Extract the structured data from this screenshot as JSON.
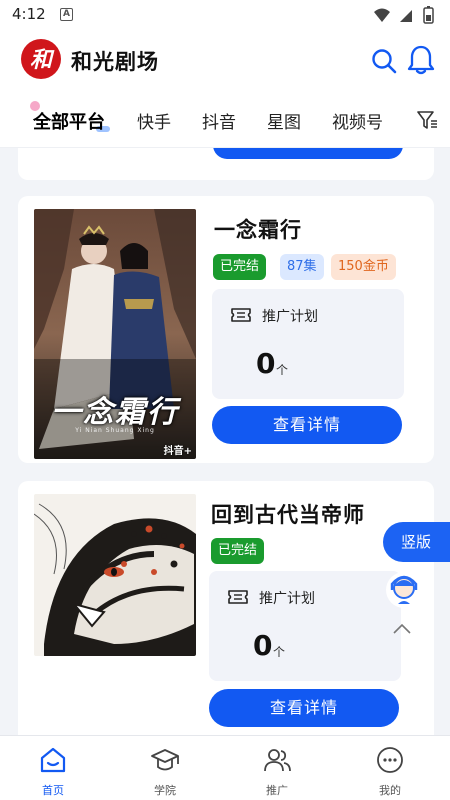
{
  "status_bar": {
    "time": "4:12",
    "notification_letter": "A"
  },
  "header": {
    "logo_char": "和",
    "title": "和光剧场",
    "icons": [
      "search-icon",
      "bell-icon"
    ]
  },
  "tabs": [
    {
      "label": "全部平台",
      "active": true
    },
    {
      "label": "快手",
      "active": false
    },
    {
      "label": "抖音",
      "active": false
    },
    {
      "label": "星图",
      "active": false
    },
    {
      "label": "视频号",
      "active": false
    }
  ],
  "dramas": [
    {
      "title": "一念霜行",
      "poster_caption": "一念霜行",
      "poster_subtitle": "Yi Nian Shuang Xing",
      "poster_watermark": "抖音+",
      "tags": [
        "已完结",
        "87集",
        "150金币"
      ],
      "plan_label": "推广计划",
      "plan_count": "0",
      "plan_unit": "个",
      "button_label": "查看详情"
    },
    {
      "title": "回到古代当帝师",
      "tags": [
        "已完结"
      ],
      "plan_label": "推广计划",
      "plan_count": "0",
      "plan_unit": "个",
      "button_label": "查看详情"
    }
  ],
  "floating": {
    "vertical_label": "竖版"
  },
  "bottom_nav": [
    {
      "label": "首页",
      "icon": "home-icon",
      "active": true
    },
    {
      "label": "学院",
      "icon": "graduation-cap-icon",
      "active": false
    },
    {
      "label": "推广",
      "icon": "users-icon",
      "active": false
    },
    {
      "label": "我的",
      "icon": "profile-face-icon",
      "active": false
    }
  ],
  "colors": {
    "primary": "#1259f2",
    "tag_green": "#1a9b2e",
    "tag_blue_bg": "#dbe8ff",
    "tag_orange_bg": "#fde4d5",
    "logo_red": "#d0161b"
  }
}
